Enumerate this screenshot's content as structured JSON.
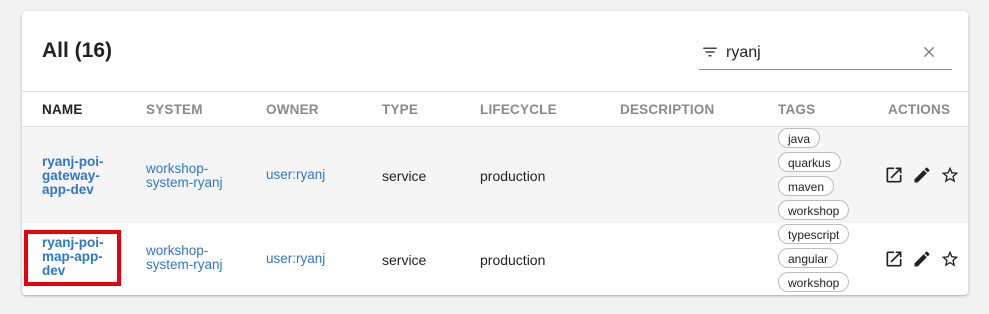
{
  "header": {
    "title": "All (16)",
    "filter_value": "ryanj",
    "filter_icon": "filter-list-icon",
    "clear_icon": "close-icon"
  },
  "columns": {
    "name": "NAME",
    "system": "SYSTEM",
    "owner": "OWNER",
    "type": "TYPE",
    "lifecycle": "LIFECYCLE",
    "description": "DESCRIPTION",
    "tags": "TAGS",
    "actions": "ACTIONS"
  },
  "rows": [
    {
      "name_lines": [
        "ryanj-poi-",
        "gateway-",
        "app-dev"
      ],
      "system_lines": [
        "workshop-",
        "system-ryanj"
      ],
      "owner": "user:ryanj",
      "type": "service",
      "lifecycle": "production",
      "description": "",
      "tags": [
        "java",
        "quarkus",
        "maven",
        "workshop"
      ],
      "actions": [
        "open-in-new-icon",
        "edit-pencil-icon",
        "star-outline-icon"
      ]
    },
    {
      "name_lines": [
        "ryanj-poi-",
        "map-app-",
        "dev"
      ],
      "system_lines": [
        "workshop-",
        "system-ryanj"
      ],
      "owner": "user:ryanj",
      "type": "service",
      "lifecycle": "production",
      "description": "",
      "tags": [
        "typescript",
        "angular",
        "workshop"
      ],
      "actions": [
        "open-in-new-icon",
        "edit-pencil-icon",
        "star-outline-icon"
      ]
    }
  ],
  "colors": {
    "link": "#2e77d0",
    "highlight": "#e8000b",
    "header_text": "#8a8a8a"
  }
}
